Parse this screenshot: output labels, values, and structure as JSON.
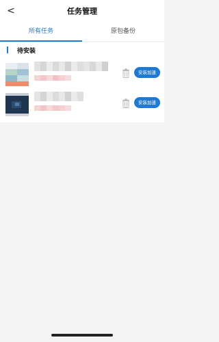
{
  "header": {
    "back_icon": "chevron-left-icon",
    "back_glyph": "<",
    "title": "任务管理"
  },
  "tabs": [
    {
      "label": "所有任务",
      "active": true
    },
    {
      "label": "原包备份",
      "active": false
    }
  ],
  "section": {
    "title": "待安装"
  },
  "apps": [
    {
      "install_label": "安装加速",
      "delete_icon": "trash-icon"
    },
    {
      "install_label": "安装加速",
      "delete_icon": "trash-icon"
    }
  ],
  "colors": {
    "accent": "#1f78d1",
    "background": "#f4f4f4",
    "card": "#ffffff"
  }
}
